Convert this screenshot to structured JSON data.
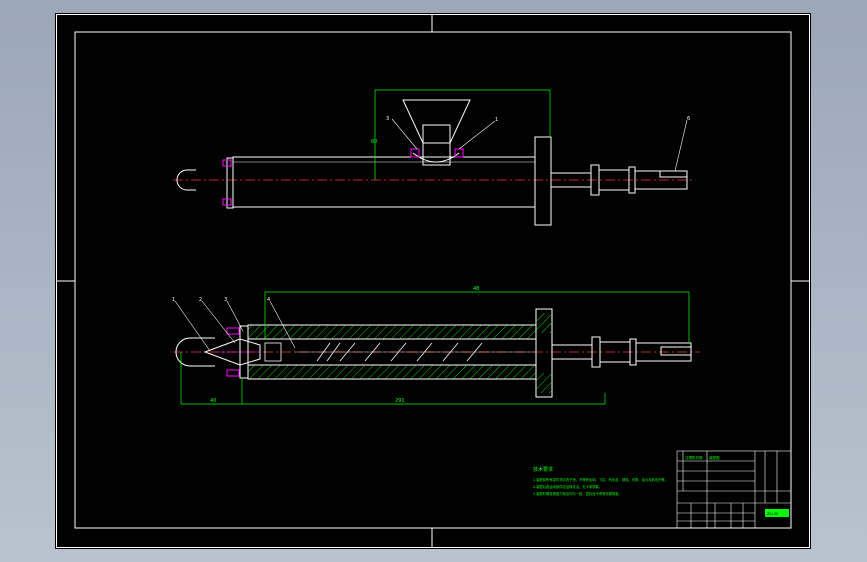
{
  "drawing": {
    "colors": {
      "outline": "#ffffff",
      "dimension": "#00ff00",
      "centerline": "#ff3333",
      "hatch": "#00ff00",
      "leader": "#ffffff",
      "accent": "#ff00ff",
      "background": "#000000"
    },
    "dims_top": {
      "d1": "80"
    },
    "dims_bottom": {
      "overall": "48",
      "left": "40",
      "mid": "291"
    },
    "top_balloons": [
      "3",
      "1",
      "6"
    ],
    "bottom_balloons": [
      "1",
      "2",
      "3",
      "4"
    ],
    "notes": {
      "heading": "技术要求",
      "line1": "1.装配前所有零件须清洗干净，不得有毛刺、飞边、氧化皮、锈蚀、切屑、油污及着色剂等。",
      "line2": "2.装配后各运动部件应运转灵活，无卡滞现象。",
      "line3": "3.装配时螺栓紧固力矩应均匀一致，密封处不得有渗漏现象。"
    },
    "title_block": {
      "label1": "注塑机机筒",
      "label2": "装配图",
      "code": "ZSJ-00"
    }
  }
}
